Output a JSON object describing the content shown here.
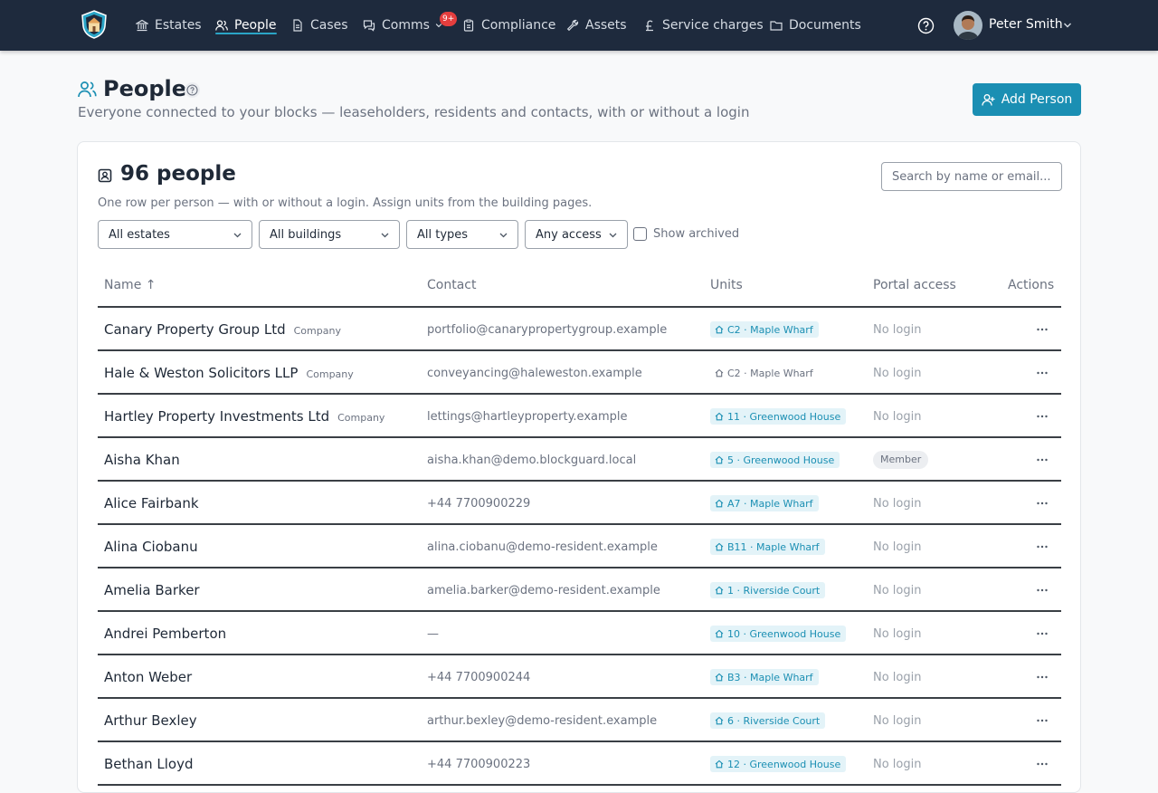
{
  "nav": {
    "items": [
      {
        "label": "Estates",
        "icon": "bank-icon"
      },
      {
        "label": "People",
        "icon": "people-icon"
      },
      {
        "label": "Cases",
        "icon": "document-icon"
      },
      {
        "label": "Comms",
        "icon": "chat-icon"
      },
      {
        "label": "Compliance",
        "icon": "clipboard-icon"
      },
      {
        "label": "Assets",
        "icon": "wrench-icon"
      },
      {
        "label": "Service charges",
        "icon": "pound-icon"
      },
      {
        "label": "Documents",
        "icon": "folder-icon"
      }
    ],
    "active": "People",
    "comms_badge": "9+",
    "user_name": "Peter Smith"
  },
  "page": {
    "title": "People",
    "subtitle": "Everyone connected to your blocks — leaseholders, residents and contacts, with or without a login",
    "add_button": "Add Person"
  },
  "card": {
    "title": "96 people",
    "subtitle": "One row per person — with or without a login. Assign units from the building pages.",
    "search_placeholder": "Search by name or email..."
  },
  "filters": {
    "estates": "All estates",
    "buildings": "All buildings",
    "types": "All types",
    "access": "Any access",
    "archived_label": "Show archived",
    "archived_checked": false
  },
  "table": {
    "columns": {
      "name": "Name ↑",
      "contact": "Contact",
      "units": "Units",
      "portal": "Portal access",
      "actions": "Actions"
    },
    "rows": [
      {
        "name": "Canary Property Group Ltd",
        "type": "Company",
        "contact": "portfolio@canarypropertygroup.example",
        "unit": "C2 · Maple Wharf",
        "unit_style": "tag",
        "portal": "No login"
      },
      {
        "name": "Hale & Weston Solicitors LLP",
        "type": "Company",
        "contact": "conveyancing@haleweston.example",
        "unit": "C2 · Maple Wharf",
        "unit_style": "plain",
        "portal": "No login"
      },
      {
        "name": "Hartley Property Investments Ltd",
        "type": "Company",
        "contact": "lettings@hartleyproperty.example",
        "unit": "11 · Greenwood House",
        "unit_style": "tag",
        "portal": "No login"
      },
      {
        "name": "Aisha Khan",
        "type": "",
        "contact": "aisha.khan@demo.blockguard.local",
        "unit": "5 · Greenwood House",
        "unit_style": "tag",
        "portal": "Member"
      },
      {
        "name": "Alice Fairbank",
        "type": "",
        "contact": "+44 7700900229",
        "unit": "A7 · Maple Wharf",
        "unit_style": "tag",
        "portal": "No login"
      },
      {
        "name": "Alina Ciobanu",
        "type": "",
        "contact": "alina.ciobanu@demo-resident.example",
        "unit": "B11 · Maple Wharf",
        "unit_style": "tag",
        "portal": "No login"
      },
      {
        "name": "Amelia Barker",
        "type": "",
        "contact": "amelia.barker@demo-resident.example",
        "unit": "1 · Riverside Court",
        "unit_style": "tag",
        "portal": "No login"
      },
      {
        "name": "Andrei Pemberton",
        "type": "",
        "contact": "—",
        "unit": "10 · Greenwood House",
        "unit_style": "tag",
        "portal": "No login"
      },
      {
        "name": "Anton Weber",
        "type": "",
        "contact": "+44 7700900244",
        "unit": "B3 · Maple Wharf",
        "unit_style": "tag",
        "portal": "No login"
      },
      {
        "name": "Arthur Bexley",
        "type": "",
        "contact": "arthur.bexley@demo-resident.example",
        "unit": "6 · Riverside Court",
        "unit_style": "tag",
        "portal": "No login"
      },
      {
        "name": "Bethan Lloyd",
        "type": "",
        "contact": "+44 7700900223",
        "unit": "12 · Greenwood House",
        "unit_style": "tag",
        "portal": "No login"
      }
    ]
  },
  "colors": {
    "nav_bg": "#1e2a3d",
    "accent": "#1b8fb3",
    "unit_tag_bg": "#e3f3f8"
  }
}
